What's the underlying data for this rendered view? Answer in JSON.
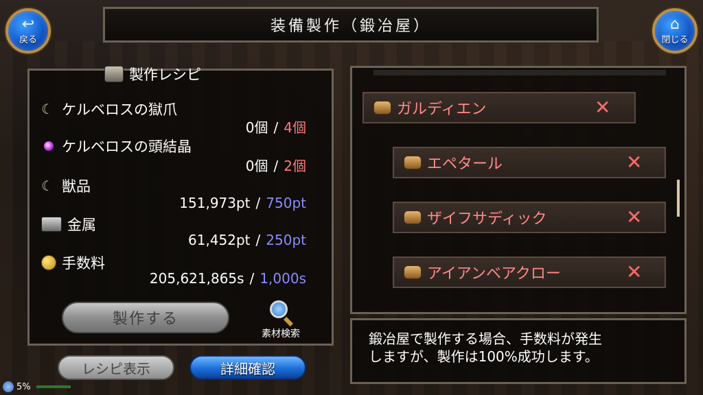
{
  "title": "装備製作（鍛冶屋）",
  "nav": {
    "back_label": "戻る",
    "back_icon": "back-arrow-icon",
    "close_label": "閉じる",
    "close_icon": "home-icon"
  },
  "recipe": {
    "header": "製作レシピ",
    "materials": [
      {
        "name": "ケルベロスの獄爪",
        "icon": "claw-icon",
        "have": "0個",
        "need": "4個",
        "need_color": "#ff7a7a"
      },
      {
        "name": "ケルベロスの頭結晶",
        "icon": "crystal-orb-icon",
        "have": "0個",
        "need": "2個",
        "need_color": "#ff7a7a"
      },
      {
        "name": "獣品",
        "icon": "claw-icon",
        "have": "151,973pt",
        "need": "750pt",
        "need_color": "#8a8cff"
      },
      {
        "name": "金属",
        "icon": "metal-ingot-icon",
        "have": "61,452pt",
        "need": "250pt",
        "need_color": "#8a8cff"
      },
      {
        "name": "手数料",
        "icon": "coin-icon",
        "have": "205,621,865s",
        "need": "1,000s",
        "need_color": "#8a8cff"
      }
    ],
    "separator": "/",
    "craft_button": "製作する",
    "search_label": "素材検索",
    "recipe_view_button": "レシピ表示",
    "detail_button": "詳細確認"
  },
  "tree": {
    "items": [
      {
        "name": "ガルディエン",
        "icon": "scroll-icon",
        "status_icon": "x-mark-icon"
      },
      {
        "name": "エペタール",
        "icon": "scroll-icon",
        "status_icon": "x-mark-icon"
      },
      {
        "name": "ザイフサディック",
        "icon": "scroll-icon",
        "status_icon": "x-mark-icon"
      },
      {
        "name": "アイアンベアクロー",
        "icon": "scroll-icon",
        "status_icon": "x-mark-icon"
      }
    ],
    "x_mark": "✕"
  },
  "info": {
    "line1": "鍛冶屋で製作する場合、手数料が発生",
    "line2": "しますが、製作は100%成功します。"
  },
  "status": {
    "percent": "5%"
  },
  "colors": {
    "accent_blue": "#1b6ed9",
    "need_red": "#ff7a7a",
    "need_blue": "#8a8cff",
    "frame": "#6b6256"
  }
}
